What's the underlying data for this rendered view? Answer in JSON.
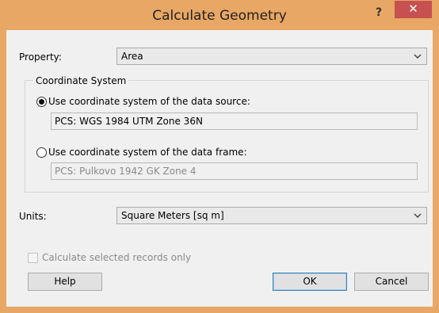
{
  "window": {
    "title": "Calculate Geometry",
    "help_glyph": "?",
    "close_glyph": "✕",
    "frame_color": "#e8a765",
    "close_color": "#c75050"
  },
  "property": {
    "label": "Property:",
    "value": "Area"
  },
  "coordinate_system": {
    "group_label": "Coordinate System",
    "source_option": {
      "label": "Use coordinate system of the data source:",
      "selected": true,
      "value": "PCS: WGS 1984 UTM Zone 36N"
    },
    "frame_option": {
      "label": "Use coordinate system of the data frame:",
      "selected": false,
      "value": "PCS: Pulkovo 1942 GK Zone 4"
    }
  },
  "units": {
    "label": "Units:",
    "value": "Square Meters [sq m]"
  },
  "selected_only": {
    "label": "Calculate selected records only",
    "checked": false,
    "enabled": false
  },
  "buttons": {
    "help": "Help",
    "ok": "OK",
    "cancel": "Cancel"
  },
  "icons": {
    "dropdown": "chevron-down-icon",
    "help": "help-icon",
    "close": "close-icon"
  }
}
